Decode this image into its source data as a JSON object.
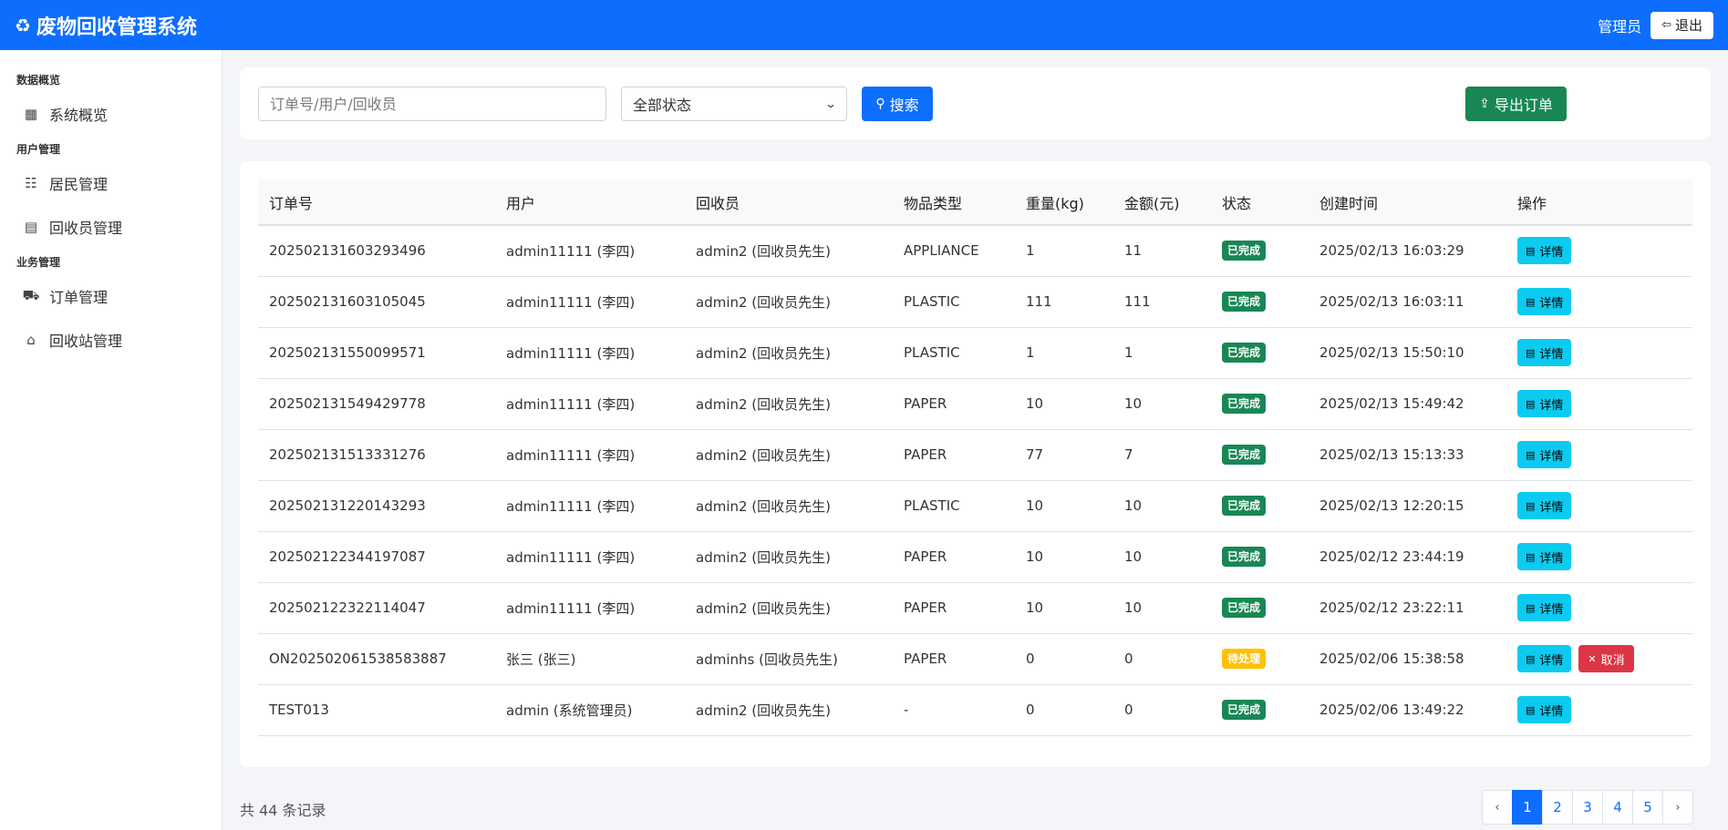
{
  "app": {
    "title": "废物回收管理系统",
    "role": "管理员",
    "logout_label": "退出"
  },
  "sidebar": {
    "sections": [
      {
        "title": "数据概览",
        "items": [
          {
            "label": "系统概览",
            "icon": "dashboard-icon"
          }
        ]
      },
      {
        "title": "用户管理",
        "items": [
          {
            "label": "居民管理",
            "icon": "users-icon"
          },
          {
            "label": "回收员管理",
            "icon": "id-badge-icon"
          }
        ]
      },
      {
        "title": "业务管理",
        "items": [
          {
            "label": "订单管理",
            "icon": "cart-icon"
          },
          {
            "label": "回收站管理",
            "icon": "shop-icon"
          }
        ]
      }
    ]
  },
  "search": {
    "placeholder": "订单号/用户/回收员",
    "status_selected": "全部状态",
    "search_label": "搜索",
    "export_label": "导出订单"
  },
  "table": {
    "columns": [
      "订单号",
      "用户",
      "回收员",
      "物品类型",
      "重量(kg)",
      "金额(元)",
      "状态",
      "创建时间",
      "操作"
    ],
    "detail_label": "详情",
    "cancel_label": "取消",
    "rows": [
      {
        "order_no": "202502131603293496",
        "user": "admin11111 (李四)",
        "collector": "admin2 (回收员先生)",
        "type": "APPLIANCE",
        "weight": "1",
        "amount": "11",
        "status": "已完成",
        "status_kind": "done",
        "created": "2025/02/13 16:03:29"
      },
      {
        "order_no": "202502131603105045",
        "user": "admin11111 (李四)",
        "collector": "admin2 (回收员先生)",
        "type": "PLASTIC",
        "weight": "111",
        "amount": "111",
        "status": "已完成",
        "status_kind": "done",
        "created": "2025/02/13 16:03:11"
      },
      {
        "order_no": "202502131550099571",
        "user": "admin11111 (李四)",
        "collector": "admin2 (回收员先生)",
        "type": "PLASTIC",
        "weight": "1",
        "amount": "1",
        "status": "已完成",
        "status_kind": "done",
        "created": "2025/02/13 15:50:10"
      },
      {
        "order_no": "202502131549429778",
        "user": "admin11111 (李四)",
        "collector": "admin2 (回收员先生)",
        "type": "PAPER",
        "weight": "10",
        "amount": "10",
        "status": "已完成",
        "status_kind": "done",
        "created": "2025/02/13 15:49:42"
      },
      {
        "order_no": "202502131513331276",
        "user": "admin11111 (李四)",
        "collector": "admin2 (回收员先生)",
        "type": "PAPER",
        "weight": "77",
        "amount": "7",
        "status": "已完成",
        "status_kind": "done",
        "created": "2025/02/13 15:13:33"
      },
      {
        "order_no": "202502131220143293",
        "user": "admin11111 (李四)",
        "collector": "admin2 (回收员先生)",
        "type": "PLASTIC",
        "weight": "10",
        "amount": "10",
        "status": "已完成",
        "status_kind": "done",
        "created": "2025/02/13 12:20:15"
      },
      {
        "order_no": "202502122344197087",
        "user": "admin11111 (李四)",
        "collector": "admin2 (回收员先生)",
        "type": "PAPER",
        "weight": "10",
        "amount": "10",
        "status": "已完成",
        "status_kind": "done",
        "created": "2025/02/12 23:44:19"
      },
      {
        "order_no": "202502122322114047",
        "user": "admin11111 (李四)",
        "collector": "admin2 (回收员先生)",
        "type": "PAPER",
        "weight": "10",
        "amount": "10",
        "status": "已完成",
        "status_kind": "done",
        "created": "2025/02/12 23:22:11"
      },
      {
        "order_no": "ON202502061538583887",
        "user": "张三 (张三)",
        "collector": "adminhs (回收员先生)",
        "type": "PAPER",
        "weight": "0",
        "amount": "0",
        "status": "待处理",
        "status_kind": "pending",
        "created": "2025/02/06 15:38:58",
        "cancelable": true
      },
      {
        "order_no": "TEST013",
        "user": "admin (系统管理员)",
        "collector": "admin2 (回收员先生)",
        "type": "-",
        "weight": "0",
        "amount": "0",
        "status": "已完成",
        "status_kind": "done",
        "created": "2025/02/06 13:49:22"
      }
    ]
  },
  "footer": {
    "total_text": "共 44 条记录",
    "pages": [
      "1",
      "2",
      "3",
      "4",
      "5"
    ],
    "active_page": "1"
  },
  "colors": {
    "primary": "#0d6efd",
    "success": "#198754",
    "warning": "#ffc107",
    "danger": "#dc3545",
    "info": "#0dcaf0"
  }
}
